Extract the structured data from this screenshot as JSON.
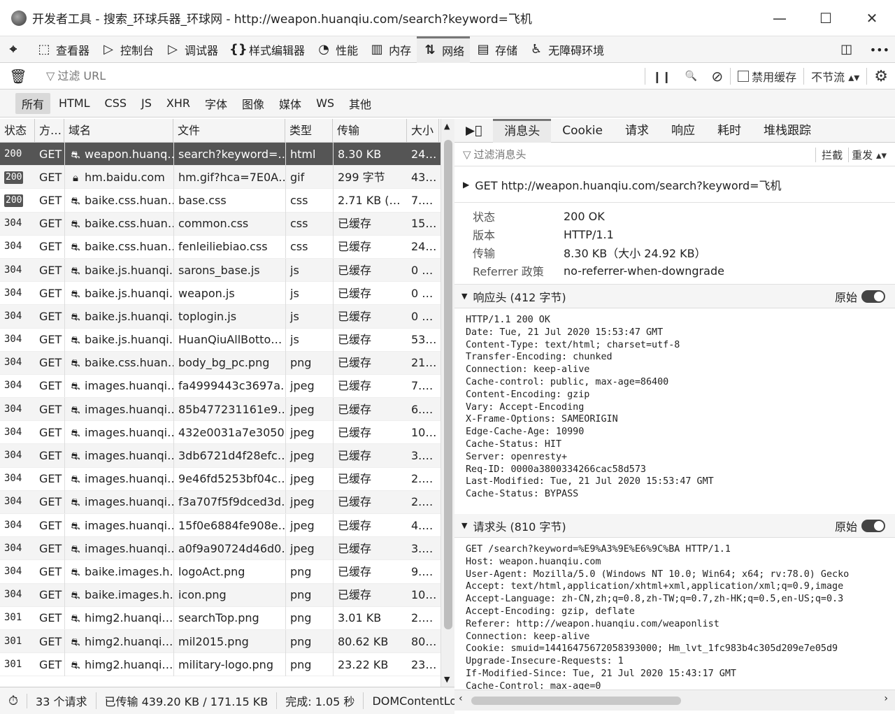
{
  "window": {
    "title": "开发者工具 - 搜索_环球兵器_环球网 - http://weapon.huanqiu.com/search?keyword=飞机",
    "minimize": "—",
    "maximize": "☐",
    "close": "✕"
  },
  "toolbar": {
    "picker_icon": "⌖",
    "tools": [
      {
        "label": "查看器",
        "icon": "⬚"
      },
      {
        "label": "控制台",
        "icon": "▷"
      },
      {
        "label": "调试器",
        "icon": "▷"
      },
      {
        "label": "样式编辑器",
        "icon": "{}"
      },
      {
        "label": "性能",
        "icon": "◔"
      },
      {
        "label": "内存",
        "icon": "▥"
      },
      {
        "label": "网络",
        "icon": "⇅"
      },
      {
        "label": "存储",
        "icon": "▤"
      },
      {
        "label": "无障碍环境",
        "icon": "♿"
      }
    ],
    "dock_icon": "◫",
    "more_icon": "•••"
  },
  "filterbar": {
    "trash_icon": "🗑",
    "placeholder": "过滤 URL",
    "pause_icon": "❙❙",
    "search_icon": "🔍",
    "block_icon": "⊘",
    "disable_cache_label": "禁用缓存",
    "throttle_label": "不节流 ▴▾",
    "settings_icon": "⚙"
  },
  "typefilters": [
    "所有",
    "HTML",
    "CSS",
    "JS",
    "XHR",
    "字体",
    "图像",
    "媒体",
    "WS",
    "其他"
  ],
  "requests": {
    "headers": [
      "状态",
      "方…",
      "域名",
      "文件",
      "类型",
      "传输",
      "大小"
    ],
    "rows": [
      {
        "status": "200",
        "method": "GET",
        "domain": "weapon.huanq…",
        "file": "search?keyword=…",
        "type": "html",
        "transfer": "8.30 KB",
        "size": "24…",
        "lock": false
      },
      {
        "status": "200",
        "method": "GET",
        "domain": "hm.baidu.com",
        "file": "hm.gif?hca=7E0A…",
        "type": "gif",
        "transfer": "299 字节",
        "size": "43…",
        "lock": true
      },
      {
        "status": "200",
        "method": "GET",
        "domain": "baike.css.huan…",
        "file": "base.css",
        "type": "css",
        "transfer": "2.71 KB (…",
        "size": "7.…",
        "lock": false
      },
      {
        "status": "304",
        "method": "GET",
        "domain": "baike.css.huan…",
        "file": "common.css",
        "type": "css",
        "transfer": "已缓存",
        "size": "15…",
        "lock": false
      },
      {
        "status": "304",
        "method": "GET",
        "domain": "baike.css.huan…",
        "file": "fenleiliebiao.css",
        "type": "css",
        "transfer": "已缓存",
        "size": "24…",
        "lock": false
      },
      {
        "status": "304",
        "method": "GET",
        "domain": "baike.js.huanqi…",
        "file": "sarons_base.js",
        "type": "js",
        "transfer": "已缓存",
        "size": "0 …",
        "lock": false
      },
      {
        "status": "304",
        "method": "GET",
        "domain": "baike.js.huanqi…",
        "file": "weapon.js",
        "type": "js",
        "transfer": "已缓存",
        "size": "0 …",
        "lock": false
      },
      {
        "status": "304",
        "method": "GET",
        "domain": "baike.js.huanqi…",
        "file": "toplogin.js",
        "type": "js",
        "transfer": "已缓存",
        "size": "0 …",
        "lock": false
      },
      {
        "status": "304",
        "method": "GET",
        "domain": "baike.js.huanqi…",
        "file": "HuanQiuAllBotto…",
        "type": "js",
        "transfer": "已缓存",
        "size": "53…",
        "lock": false
      },
      {
        "status": "304",
        "method": "GET",
        "domain": "baike.css.huan…",
        "file": "body_bg_pc.png",
        "type": "png",
        "transfer": "已缓存",
        "size": "21…",
        "lock": false
      },
      {
        "status": "304",
        "method": "GET",
        "domain": "images.huanqi…",
        "file": "fa4999443c3697a…",
        "type": "jpeg",
        "transfer": "已缓存",
        "size": "7.…",
        "lock": false
      },
      {
        "status": "304",
        "method": "GET",
        "domain": "images.huanqi…",
        "file": "85b477231161e9…",
        "type": "jpeg",
        "transfer": "已缓存",
        "size": "6.…",
        "lock": false
      },
      {
        "status": "304",
        "method": "GET",
        "domain": "images.huanqi…",
        "file": "432e0031a7e3050…",
        "type": "jpeg",
        "transfer": "已缓存",
        "size": "10…",
        "lock": false
      },
      {
        "status": "304",
        "method": "GET",
        "domain": "images.huanqi…",
        "file": "3db6721d4f28efc…",
        "type": "jpeg",
        "transfer": "已缓存",
        "size": "3.…",
        "lock": false
      },
      {
        "status": "304",
        "method": "GET",
        "domain": "images.huanqi…",
        "file": "9e46fd5253bf04c…",
        "type": "jpeg",
        "transfer": "已缓存",
        "size": "2.…",
        "lock": false
      },
      {
        "status": "304",
        "method": "GET",
        "domain": "images.huanqi…",
        "file": "f3a707f5f9dced3d…",
        "type": "jpeg",
        "transfer": "已缓存",
        "size": "2.…",
        "lock": false
      },
      {
        "status": "304",
        "method": "GET",
        "domain": "images.huanqi…",
        "file": "15f0e6884fe908e…",
        "type": "jpeg",
        "transfer": "已缓存",
        "size": "4.…",
        "lock": false
      },
      {
        "status": "304",
        "method": "GET",
        "domain": "images.huanqi…",
        "file": "a0f9a90724d46d0…",
        "type": "jpeg",
        "transfer": "已缓存",
        "size": "3.…",
        "lock": false
      },
      {
        "status": "304",
        "method": "GET",
        "domain": "baike.images.h…",
        "file": "logoAct.png",
        "type": "png",
        "transfer": "已缓存",
        "size": "9.…",
        "lock": false
      },
      {
        "status": "304",
        "method": "GET",
        "domain": "baike.images.h…",
        "file": "icon.png",
        "type": "png",
        "transfer": "已缓存",
        "size": "10…",
        "lock": false
      },
      {
        "status": "301",
        "method": "GET",
        "domain": "himg2.huanqi…",
        "file": "searchTop.png",
        "type": "png",
        "transfer": "3.01 KB",
        "size": "2.…",
        "lock": false
      },
      {
        "status": "301",
        "method": "GET",
        "domain": "himg2.huanqi…",
        "file": "mil2015.png",
        "type": "png",
        "transfer": "80.62 KB",
        "size": "80…",
        "lock": false
      },
      {
        "status": "301",
        "method": "GET",
        "domain": "himg2.huanqi…",
        "file": "military-logo.png",
        "type": "png",
        "transfer": "23.22 KB",
        "size": "23…",
        "lock": false
      }
    ]
  },
  "statusbar": {
    "count": "33 个请求",
    "transferred": "已传输 439.20 KB / 171.15 KB",
    "finish": "完成: 1.05 秒",
    "domcontent": "DOMContentLoa"
  },
  "detail": {
    "tabs": [
      "消息头",
      "Cookie",
      "请求",
      "响应",
      "耗时",
      "堆栈跟踪"
    ],
    "filter_placeholder": "过滤消息头",
    "block_label": "拦截",
    "resend_label": "重发 ▴▾",
    "request_line": "GET  http://weapon.huanqiu.com/search?keyword=飞机",
    "summary": [
      {
        "k": "状态",
        "v": "200 OK"
      },
      {
        "k": "版本",
        "v": "HTTP/1.1"
      },
      {
        "k": "传输",
        "v": "8.30 KB（大小 24.92 KB）"
      },
      {
        "k": "Referrer 政策",
        "v": "no-referrer-when-downgrade"
      }
    ],
    "response_headers_title": "响应头 (412 字节)",
    "request_headers_title": "请求头 (810 字节)",
    "raw_label": "原始",
    "response_raw": "HTTP/1.1 200 OK\nDate: Tue, 21 Jul 2020 15:53:47 GMT\nContent-Type: text/html; charset=utf-8\nTransfer-Encoding: chunked\nConnection: keep-alive\nCache-control: public, max-age=86400\nContent-Encoding: gzip\nVary: Accept-Encoding\nX-Frame-Options: SAMEORIGIN\nEdge-Cache-Age: 10990\nCache-Status: HIT\nServer: openresty+\nReq-ID: 0000a3800334266cac58d573\nLast-Modified: Tue, 21 Jul 2020 15:53:47 GMT\nCache-Status: BYPASS",
    "request_raw": "GET /search?keyword=%E9%A3%9E%E6%9C%BA HTTP/1.1\nHost: weapon.huanqiu.com\nUser-Agent: Mozilla/5.0 (Windows NT 10.0; Win64; x64; rv:78.0) Gecko\nAccept: text/html,application/xhtml+xml,application/xml;q=0.9,image\nAccept-Language: zh-CN,zh;q=0.8,zh-TW;q=0.7,zh-HK;q=0.5,en-US;q=0.3\nAccept-Encoding: gzip, deflate\nReferer: http://weapon.huanqiu.com/weaponlist\nConnection: keep-alive\nCookie: smuid=14416475672058393000; Hm_lvt_1fc983b4c305d209e7e05d9\nUpgrade-Insecure-Requests: 1\nIf-Modified-Since: Tue, 21 Jul 2020 15:43:17 GMT\nCache-Control: max-age=0"
  }
}
